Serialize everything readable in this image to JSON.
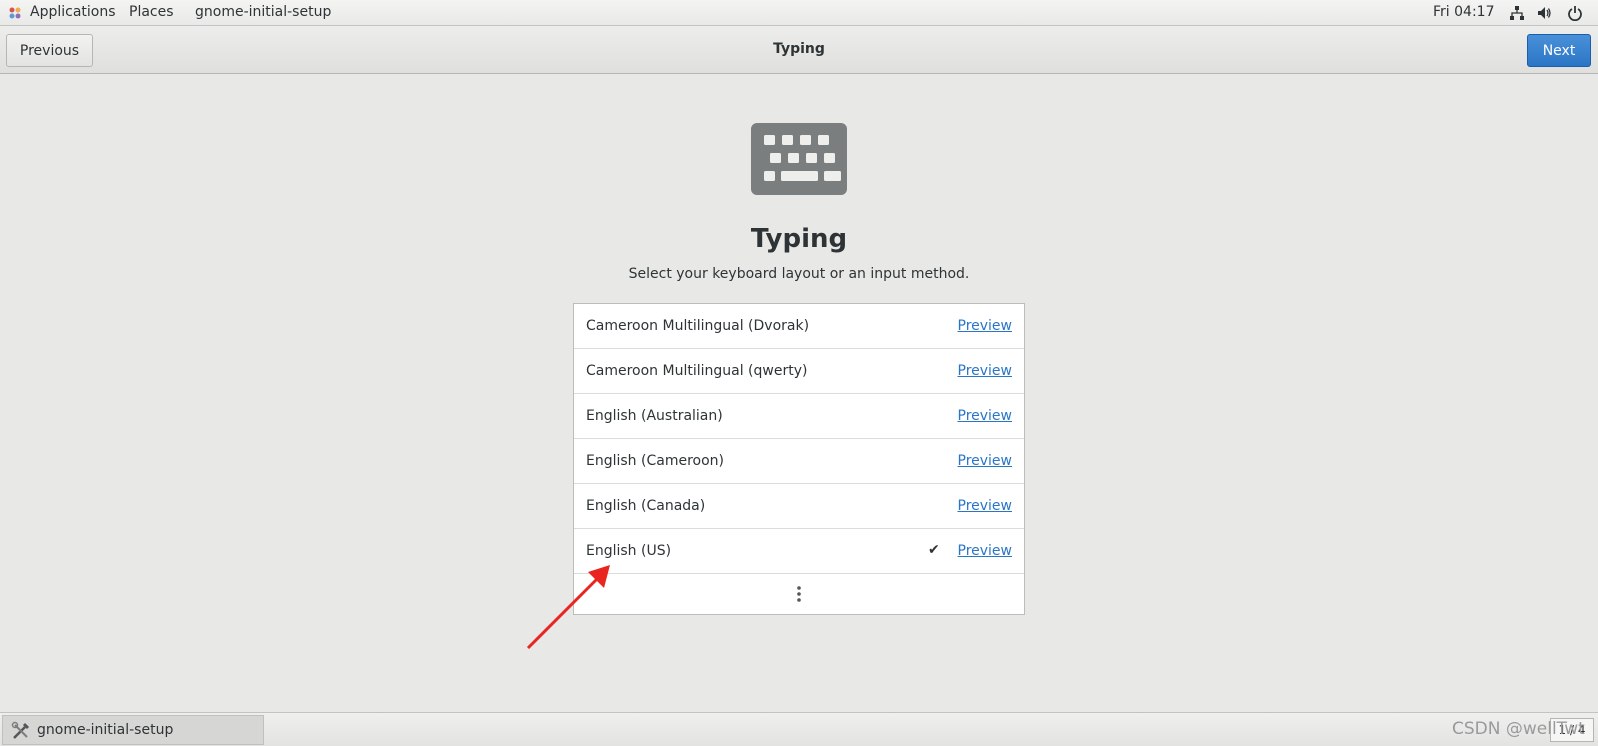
{
  "top_panel": {
    "applications": "Applications",
    "places": "Places",
    "app_name": "gnome-initial-setup",
    "clock": "Fri 04:17"
  },
  "headerbar": {
    "previous": "Previous",
    "title": "Typing",
    "next": "Next"
  },
  "main": {
    "icon": "keyboard-icon",
    "heading": "Typing",
    "subtitle": "Select your keyboard layout or an input method."
  },
  "layouts": [
    {
      "name": "Cameroon Multilingual (Dvorak)",
      "preview": "Preview",
      "selected": false
    },
    {
      "name": "Cameroon Multilingual (qwerty)",
      "preview": "Preview",
      "selected": false
    },
    {
      "name": "English (Australian)",
      "preview": "Preview",
      "selected": false
    },
    {
      "name": "English (Cameroon)",
      "preview": "Preview",
      "selected": false
    },
    {
      "name": "English (Canada)",
      "preview": "Preview",
      "selected": false
    },
    {
      "name": "English (US)",
      "preview": "Preview",
      "selected": true,
      "check": "✔"
    }
  ],
  "bottom_panel": {
    "taskbar_label": "gnome-initial-setup",
    "workspace": "1 / 4"
  },
  "watermark": "CSDN @wellTwt",
  "colors": {
    "accent": "#2a76c6",
    "annotation_arrow": "#e8261f"
  }
}
